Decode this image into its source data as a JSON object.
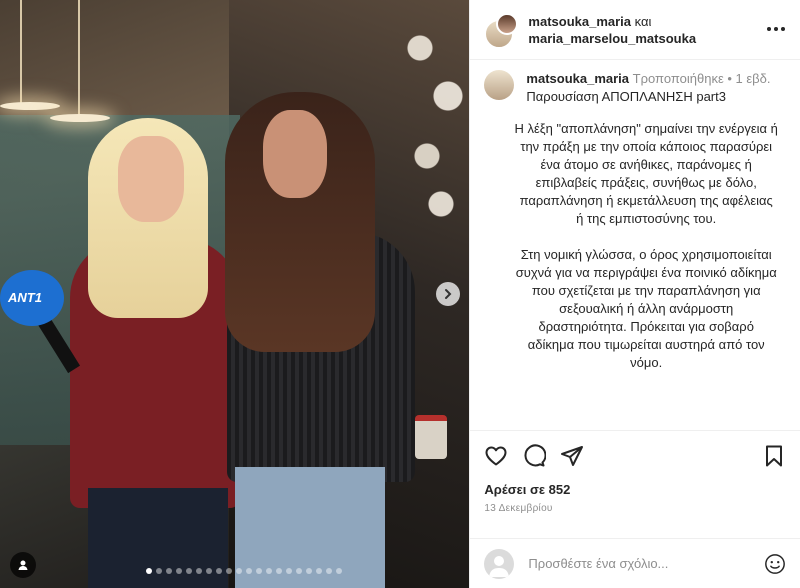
{
  "header": {
    "user1": "matsouka_maria",
    "conj": "και",
    "user2": "maria_marselou_matsouka",
    "more_icon": "more-horizontal-icon"
  },
  "caption": {
    "username": "matsouka_maria",
    "meta": "Τροποποιήθηκε • 1 εβδ.",
    "title": "Παρουσίαση ΑΠΟΠΛΑΝΗΣΗ part3",
    "paragraph1": "Η λέξη \"αποπλάνηση\" σημαίνει την ενέργεια ή την πράξη με την οποία κάποιος παρασύρει ένα άτομο σε ανήθικες, παράνομες ή επιβλαβείς πράξεις, συνήθως με δόλο, παραπλάνηση ή εκμετάλλευση της αφέλειας ή της εμπιστοσύνης του.",
    "paragraph2": "Στη νομική γλώσσα, ο όρος χρησιμοποιείται συχνά για να περιγράψει ένα ποινικό αδίκημα που σχετίζεται με την παραπλάνηση για σεξουαλική ή άλλη ανάρμοστη δραστηριότητα. Πρόκειται για σοβαρό αδίκημα που τιμωρείται αυστηρά από τον νόμο."
  },
  "media": {
    "mic_label": "ANT1",
    "carousel_count": 20,
    "carousel_active": 0
  },
  "actions": {
    "like_icon": "heart-icon",
    "comment_icon": "comment-icon",
    "share_icon": "send-icon",
    "save_icon": "bookmark-icon"
  },
  "likes": "Αρέσει σε 852",
  "date": "13 Δεκεμβρίου",
  "comment": {
    "placeholder": "Προσθέστε ένα σχόλιο...",
    "emoji_icon": "emoji-icon"
  }
}
